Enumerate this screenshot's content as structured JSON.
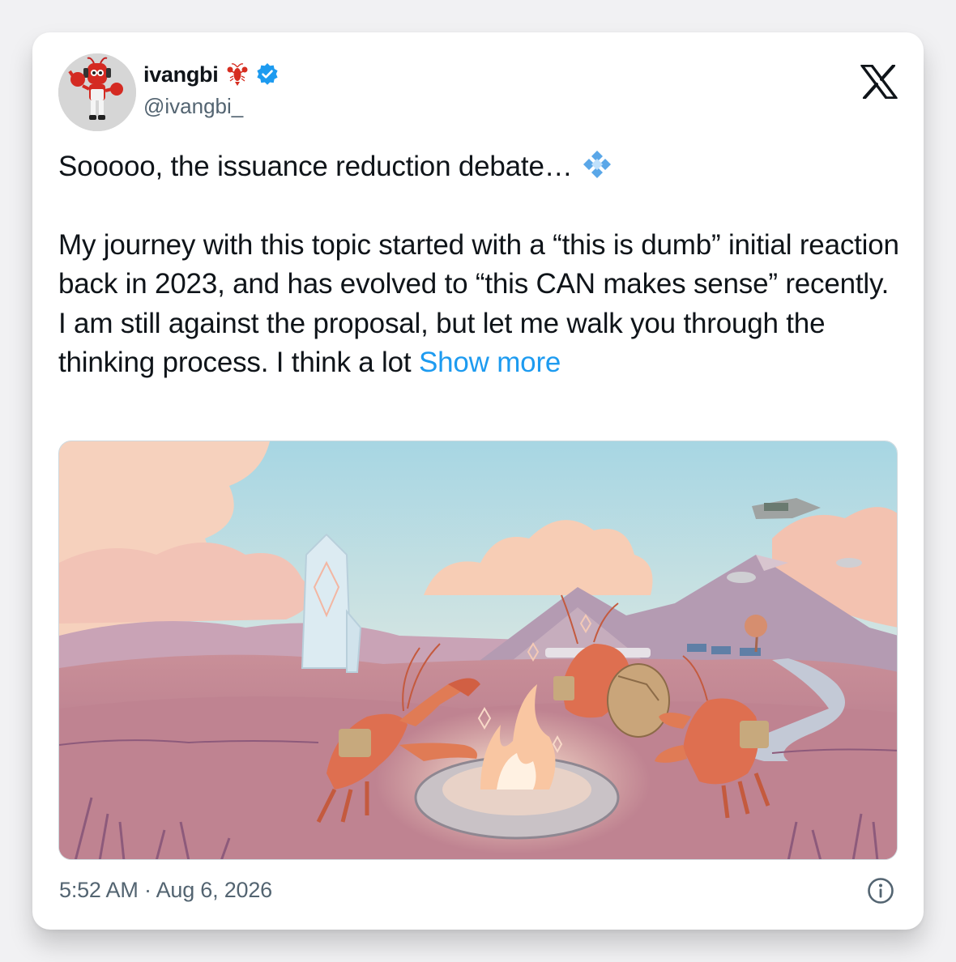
{
  "author": {
    "display_name": "ivangbi",
    "name_emoji": "lobster-emoji",
    "verified": true,
    "handle": "@ivangbi_",
    "avatar": "red-robot-lobster-avatar"
  },
  "platform_logo": "x-logo",
  "tweet": {
    "title_line": "Sooooo, the issuance reduction debate…",
    "emoji_after_title": "",
    "body": "My journey with this topic started with a “this is dumb” initial reaction back in 2023, and has evolved to “this CAN makes sense” recently. I am still against the proposal, but let me walk you through the thinking process. I think a lot",
    "show_more_label": "Show more"
  },
  "media": {
    "alt": ""
  },
  "timestamp": "5:52 AM · Aug 6, 2026",
  "colors": {
    "link": "#1d9bf0",
    "text": "#0f1419",
    "secondary": "#536471",
    "verified": "#1d9bf0"
  }
}
